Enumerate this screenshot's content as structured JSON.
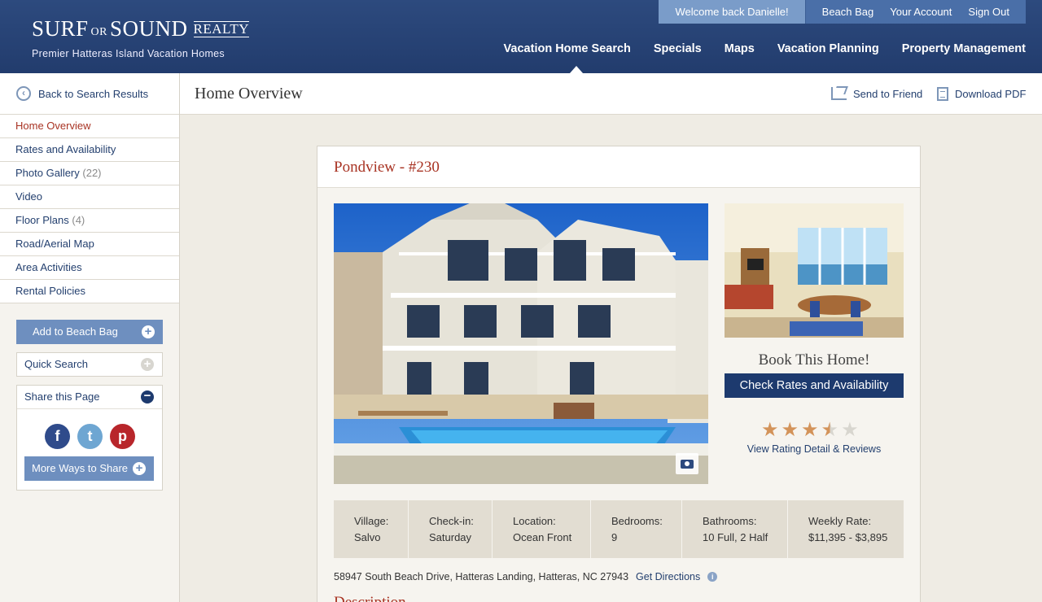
{
  "brand": {
    "logo_surf": "SURF",
    "logo_or": "OR",
    "logo_sound": "SOUND",
    "logo_realty": "REALTY",
    "tagline": "Premier Hatteras Island Vacation Homes"
  },
  "utility": {
    "welcome": "Welcome back Danielle!",
    "links": [
      "Beach Bag",
      "Your Account",
      "Sign Out"
    ]
  },
  "nav": [
    "Vacation Home Search",
    "Specials",
    "Maps",
    "Vacation Planning",
    "Property Management"
  ],
  "sidebar": {
    "back": "Back to Search Results",
    "items": [
      {
        "label": "Home Overview",
        "count": ""
      },
      {
        "label": "Rates and Availability",
        "count": ""
      },
      {
        "label": "Photo Gallery",
        "count": "(22)"
      },
      {
        "label": "Video",
        "count": ""
      },
      {
        "label": "Floor Plans",
        "count": "(4)"
      },
      {
        "label": "Road/Aerial Map",
        "count": ""
      },
      {
        "label": "Area Activities",
        "count": ""
      },
      {
        "label": "Rental Policies",
        "count": ""
      }
    ],
    "add_beach_bag": "Add to Beach Bag",
    "quick_search": "Quick Search",
    "share_page": "Share this Page",
    "more_share": "More Ways to Share",
    "social": {
      "facebook": "f",
      "twitter": "t",
      "pinterest": "p"
    }
  },
  "topbar": {
    "title": "Home Overview",
    "send": "Send to Friend",
    "pdf": "Download PDF"
  },
  "property": {
    "title": "Pondview - #230",
    "book_title": "Book This Home!",
    "book_button": "Check Rates and Availability",
    "rating": 3.5,
    "rating_max": 5,
    "rating_link": "View Rating Detail & Reviews",
    "facts": [
      {
        "label": "Village:",
        "value": "Salvo"
      },
      {
        "label": "Check-in:",
        "value": "Saturday"
      },
      {
        "label": "Location:",
        "value": "Ocean Front"
      },
      {
        "label": "Bedrooms:",
        "value": "9"
      },
      {
        "label": "Bathrooms:",
        "value": "10 Full, 2 Half"
      },
      {
        "label": "Weekly Rate:",
        "value": "$11,395 - $3,895"
      }
    ],
    "address": "58947 South Beach Drive, Hatteras Landing, Hatteras, NC 27943",
    "directions": "Get Directions",
    "description_heading": "Description"
  },
  "colors": {
    "header": "#2d4a7e",
    "accent_red": "#a83323",
    "link_blue": "#24406f",
    "button_blue": "#1d3a6e",
    "soft_blue": "#6e8fbf"
  }
}
